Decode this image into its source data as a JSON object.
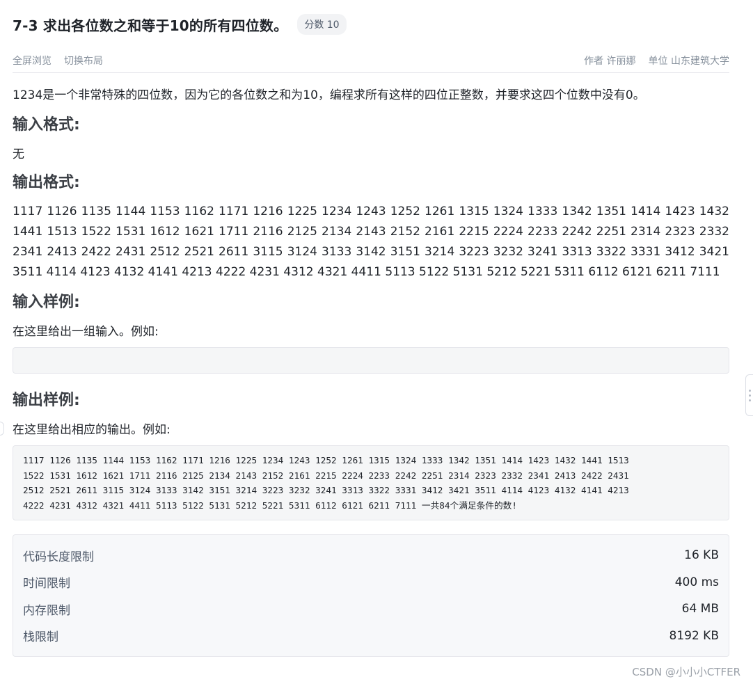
{
  "header": {
    "title": "7-3 求出各位数之和等于10的所有四位数。",
    "score_badge": "分数 10"
  },
  "meta": {
    "fullscreen_label": "全屏浏览",
    "switch_layout_label": "切换布局",
    "author_label": "作者",
    "author_value": "许丽娜",
    "unit_label": "单位",
    "unit_value": "山东建筑大学"
  },
  "problem": {
    "description": "1234是一个非常特殊的四位数，因为它的各位数之和为10，编程求所有这样的四位正整数，并要求这四个位数中没有0。",
    "input_format_heading": "输入格式:",
    "input_format_text": "无",
    "output_format_heading": "输出格式:",
    "output_format_text": "1117 1126 1135 1144 1153 1162 1171 1216 1225 1234 1243 1252 1261 1315 1324 1333 1342 1351 1414 1423 1432 1441 1513 1522 1531 1612 1621 1711 2116 2125 2134 2143 2152 2161 2215 2224 2233 2242 2251 2314 2323 2332 2341 2413 2422 2431 2512 2521 2611 3115 3124 3133 3142 3151 3214 3223 3232 3241 3313 3322 3331 3412 3421 3511 4114 4123 4132 4141 4213 4222 4231 4312 4321 4411 5113 5122 5131 5212 5221 5311 6112 6121 6211 7111",
    "sample_input_heading": "输入样例:",
    "sample_input_intro": "在这里给出一组输入。例如:",
    "sample_input_content": "",
    "sample_output_heading": "输出样例:",
    "sample_output_intro": "在这里给出相应的输出。例如:",
    "sample_output_content": "1117 1126 1135 1144 1153 1162 1171 1216 1225 1234 1243 1252 1261 1315 1324 1333 1342 1351 1414 1423 1432 1441 1513\n1522 1531 1612 1621 1711 2116 2125 2134 2143 2152 2161 2215 2224 2233 2242 2251 2314 2323 2332 2341 2413 2422 2431\n2512 2521 2611 3115 3124 3133 3142 3151 3214 3223 3232 3241 3313 3322 3331 3412 3421 3511 4114 4123 4132 4141 4213\n4222 4231 4312 4321 4411 5113 5122 5131 5212 5221 5311 6112 6121 6211 7111 一共84个满足条件的数!"
  },
  "limits": [
    {
      "label": "代码长度限制",
      "value": "16 KB"
    },
    {
      "label": "时间限制",
      "value": "400 ms"
    },
    {
      "label": "内存限制",
      "value": "64 MB"
    },
    {
      "label": "栈限制",
      "value": "8192 KB"
    }
  ],
  "watermark": "CSDN @小小小CTFER",
  "icons": {
    "scroll_handle": "drag-handle-icon"
  }
}
